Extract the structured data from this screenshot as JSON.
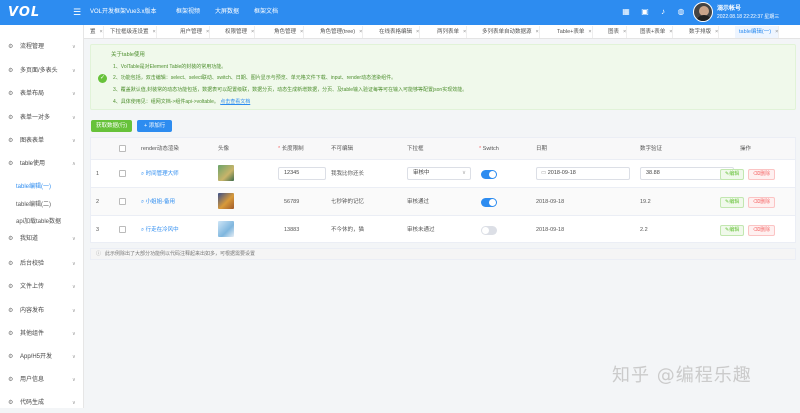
{
  "header": {
    "logo": "VOL",
    "app_title": "VOL开发框架Vue3.x版本",
    "nav": [
      "框架视频",
      "大屏数据",
      "框架文档"
    ],
    "user_name": "溺示帐号",
    "user_datetime": "2022.08.18 22:22:37 星期三",
    "icons": [
      "menu-icon",
      "grid-icon",
      "image-icon",
      "bell-icon",
      "globe-icon"
    ]
  },
  "sidebar": {
    "items": [
      {
        "label": "流程管理",
        "icon": "flow-icon"
      },
      {
        "label": "多页面/多表头",
        "icon": "pages-icon"
      },
      {
        "label": "表单布局",
        "icon": "layout-icon"
      },
      {
        "label": "表单一对多",
        "icon": "list-icon"
      },
      {
        "label": "图表表单",
        "icon": "chart-icon"
      },
      {
        "label": "table使用",
        "icon": "table-icon",
        "expanded": true
      },
      {
        "label": "我知道",
        "icon": "info-icon"
      },
      {
        "label": "后台校验",
        "icon": "check-icon"
      },
      {
        "label": "文件上传",
        "icon": "upload-icon"
      },
      {
        "label": "内容发布",
        "icon": "publish-icon"
      },
      {
        "label": "其他组件",
        "icon": "component-icon"
      },
      {
        "label": "App/H5开发",
        "icon": "mobile-icon"
      },
      {
        "label": "用户信息",
        "icon": "user-icon"
      },
      {
        "label": "代码生成",
        "icon": "code-icon"
      }
    ],
    "subitems": [
      "table编辑(一)",
      "table编辑(二)",
      "api加载table数据"
    ]
  },
  "tabs": [
    "置",
    "下拉框级连设置",
    "用户管理",
    "权限管理",
    "角色管理",
    "角色管理(tree)",
    "在线表格编辑",
    "两列表单",
    "多列表单自动数据源",
    "Table+表单",
    "图表",
    "图表+表单",
    "数字排版",
    "table编辑(一)"
  ],
  "notice": {
    "title": "关于table使用",
    "lines": [
      "1、VolTable是对Element Table的封装的常用功能。",
      "2、功能包括，双击编辑：select、select联动、switch、日期、图片显示与预览、单元格文件下载、input、render动态渲染组件。",
      "3、覆盖默认值,封装常的动态功能包括，数据表可以配置级联，数据分页，动态生成新增数据，分页、及table输入验证每等可在输入可能够等配置json实现效能。",
      "4、具体使用见：组网文档->组件api->voltable。"
    ],
    "link": "点击查看文档"
  },
  "actions": {
    "get_data": "获取数据(行)",
    "add_row": "+ 添加行"
  },
  "table": {
    "columns": [
      "",
      "",
      "render动态渲染",
      "头像",
      "长度限制",
      "不可编辑",
      "下拉框",
      "Switch",
      "日期",
      "数字验证",
      "操作"
    ],
    "rows": [
      {
        "no": "1",
        "render": "时间管理大师",
        "length": "12345",
        "readonly": "我我比你还长",
        "select": "审核中",
        "switch_on": true,
        "date": "2018-09-18",
        "number": "38.88",
        "edit": "编辑",
        "delete": "删除"
      },
      {
        "no": "2",
        "render": "小姐姐-备用",
        "length": "56789",
        "readonly": "七秒钟的记忆",
        "select": "审核通过",
        "switch_on": true,
        "date": "2018-09-18",
        "number": "19.2",
        "edit": "编辑",
        "delete": "删除"
      },
      {
        "no": "3",
        "render": "行走在冷风中",
        "length": "13883",
        "readonly": "不今休的，猫",
        "select": "审核未通过",
        "switch_on": false,
        "date": "2018-09-18",
        "number": "2.2",
        "edit": "编辑",
        "delete": "删除"
      }
    ]
  },
  "footer": {
    "text": "此示例除出了大部分功能例以代码注释起来出如多，可根据需要设置"
  },
  "watermark": "知乎 @编程乐趣",
  "colors": {
    "primary": "#2d8cf0",
    "success": "#67c23a",
    "danger": "#f56c6c",
    "notice_bg": "#f0f9eb"
  }
}
